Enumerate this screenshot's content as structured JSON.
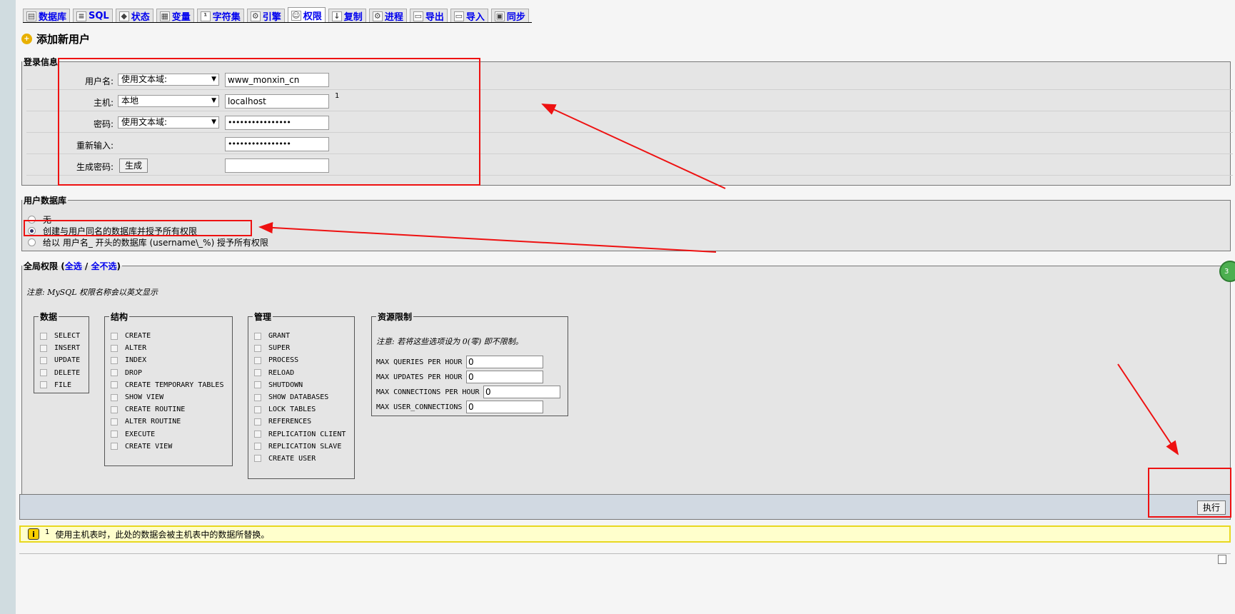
{
  "tabs": [
    {
      "label": "数据库",
      "icon": "database-icon",
      "glyph": "▤"
    },
    {
      "label": "SQL",
      "icon": "sql-icon",
      "glyph": "≡"
    },
    {
      "label": "状态",
      "icon": "status-icon",
      "glyph": "◆"
    },
    {
      "label": "变量",
      "icon": "variables-icon",
      "glyph": "▦"
    },
    {
      "label": "字符集",
      "icon": "charset-icon",
      "glyph": "¹"
    },
    {
      "label": "引擎",
      "icon": "engine-icon",
      "glyph": "⚙"
    },
    {
      "label": "权限",
      "icon": "privileges-icon",
      "glyph": "☺",
      "active": true
    },
    {
      "label": "复制",
      "icon": "replication-icon",
      "glyph": "↓"
    },
    {
      "label": "进程",
      "icon": "process-icon",
      "glyph": "⚙"
    },
    {
      "label": "导出",
      "icon": "export-icon",
      "glyph": "▭"
    },
    {
      "label": "导入",
      "icon": "import-icon",
      "glyph": "▭"
    },
    {
      "label": "同步",
      "icon": "sync-icon",
      "glyph": "▣"
    }
  ],
  "page_title": "添加新用户",
  "login": {
    "legend": "登录信息",
    "username_label": "用户名:",
    "username_mode": "使用文本域:",
    "username_value": "www_monxin_cn",
    "host_label": "主机:",
    "host_mode": "本地",
    "host_value": "localhost",
    "host_footnote": "1",
    "password_label": "密码:",
    "password_mode": "使用文本域:",
    "password_value": "••••••••••••••••",
    "retype_label": "重新输入:",
    "retype_value": "••••••••••••••••",
    "generate_label": "生成密码:",
    "generate_button": "生成",
    "generated_value": ""
  },
  "userdb": {
    "legend": "用户数据库",
    "options": [
      {
        "label": "无",
        "selected": false
      },
      {
        "label": "创建与用户同名的数据库并授予所有权限",
        "selected": true
      },
      {
        "label": "给以 用户名_ 开头的数据库 (username\\_%) 授予所有权限",
        "selected": false
      }
    ]
  },
  "global": {
    "legend": "全局权限",
    "select_all": "全选",
    "slash": "/",
    "select_none": "全不选",
    "note": "注意: MySQL 权限名称会以英文显示",
    "groups": {
      "data": {
        "legend": "数据",
        "items": [
          "SELECT",
          "INSERT",
          "UPDATE",
          "DELETE",
          "FILE"
        ]
      },
      "structure": {
        "legend": "结构",
        "items": [
          "CREATE",
          "ALTER",
          "INDEX",
          "DROP",
          "CREATE TEMPORARY TABLES",
          "SHOW VIEW",
          "CREATE ROUTINE",
          "ALTER ROUTINE",
          "EXECUTE",
          "CREATE VIEW"
        ]
      },
      "admin": {
        "legend": "管理",
        "items": [
          "GRANT",
          "SUPER",
          "PROCESS",
          "RELOAD",
          "SHUTDOWN",
          "SHOW DATABASES",
          "LOCK TABLES",
          "REFERENCES",
          "REPLICATION CLIENT",
          "REPLICATION SLAVE",
          "CREATE USER"
        ]
      }
    },
    "limits": {
      "legend": "资源限制",
      "note": "注意: 若将这些选项设为 0(零) 即不限制。",
      "rows": [
        {
          "label": "MAX QUERIES PER HOUR",
          "value": "0"
        },
        {
          "label": "MAX UPDATES PER HOUR",
          "value": "0"
        },
        {
          "label": "MAX CONNECTIONS PER HOUR",
          "value": "0"
        },
        {
          "label": "MAX USER_CONNECTIONS",
          "value": "0"
        }
      ]
    }
  },
  "execute_button": "执行",
  "notice": {
    "icon": "i",
    "footnote": "1",
    "text": "使用主机表时，此处的数据会被主机表中的数据所替换。"
  },
  "side_badge": "3",
  "annotation_color": "#ee1111"
}
